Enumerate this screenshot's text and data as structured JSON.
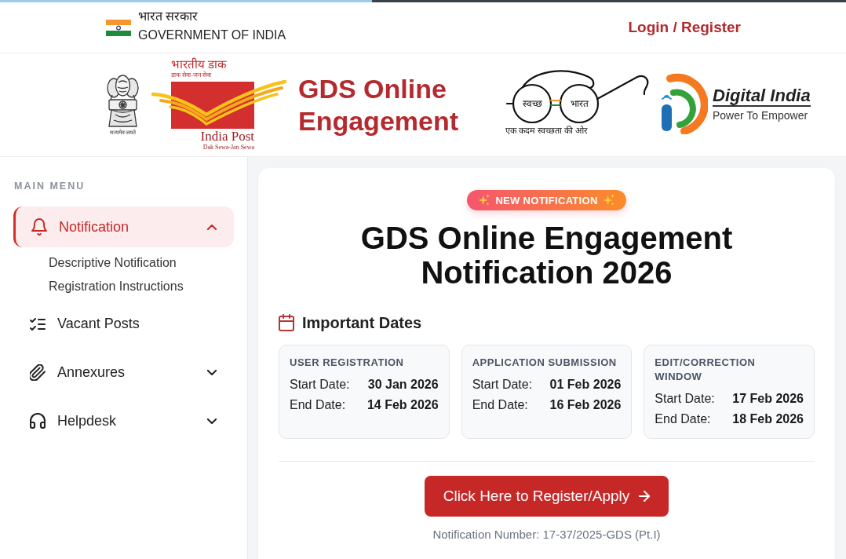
{
  "loading_bar": {
    "level": 0.44
  },
  "top_bar": {
    "gov_name_hindi": "भारत सरकार",
    "gov_name": "GOVERNMENT OF INDIA",
    "login_link": "Login / Register"
  },
  "banner": {
    "emblem": {
      "motto": "सत्यमेव जयते"
    },
    "india_post_logo": {
      "hindi_name": "भारतीय डाक",
      "hindi_tagline": "डाक सेवा-जन सेवा",
      "name": "India Post",
      "tagline": "Dak Sewa-Jan Sewa"
    },
    "site_title": "GDS Online Engagement",
    "swachh_logo": {
      "left_lens": "स्वच्छ",
      "right_lens": "भारत",
      "slogan": "एक कदम स्वच्छता की ओर"
    },
    "digital_india_logo": {
      "name": "Digital India",
      "tagline": "Power To Empower"
    }
  },
  "sidebar": {
    "heading": "MAIN MENU",
    "items": [
      {
        "label": "Notification",
        "kind": "group",
        "selected": true,
        "expanded": true,
        "children": [
          {
            "label": "Descriptive Notification"
          },
          {
            "label": "Registration Instructions"
          }
        ]
      },
      {
        "label": "Vacant Posts",
        "kind": "link",
        "selected": false
      },
      {
        "label": "Annexures",
        "kind": "group",
        "selected": false,
        "expanded": false
      },
      {
        "label": "Helpdesk",
        "kind": "group",
        "selected": false,
        "expanded": false
      }
    ]
  },
  "main": {
    "badge": "NEW NOTIFICATION",
    "title": "GDS Online Engagement Notification 2026",
    "dates_heading": "Important Dates",
    "date_cards": [
      {
        "title": "USER REGISTRATION",
        "rows": [
          {
            "label": "Start Date:",
            "value": "30 Jan 2026"
          },
          {
            "label": "End Date:",
            "value": "14 Feb 2026"
          }
        ]
      },
      {
        "title": "APPLICATION SUBMISSION",
        "rows": [
          {
            "label": "Start Date:",
            "value": "01 Feb 2026"
          },
          {
            "label": "End Date:",
            "value": "16 Feb 2026"
          }
        ]
      },
      {
        "title": "EDIT/CORRECTION WINDOW",
        "rows": [
          {
            "label": "Start Date:",
            "value": "17 Feb 2026"
          },
          {
            "label": "End Date:",
            "value": "18 Feb 2026"
          }
        ]
      }
    ],
    "register_button": "Click Here to Register/Apply",
    "notification_number": "Notification Number: 17-37/2025-GDS (Pt.I)"
  }
}
